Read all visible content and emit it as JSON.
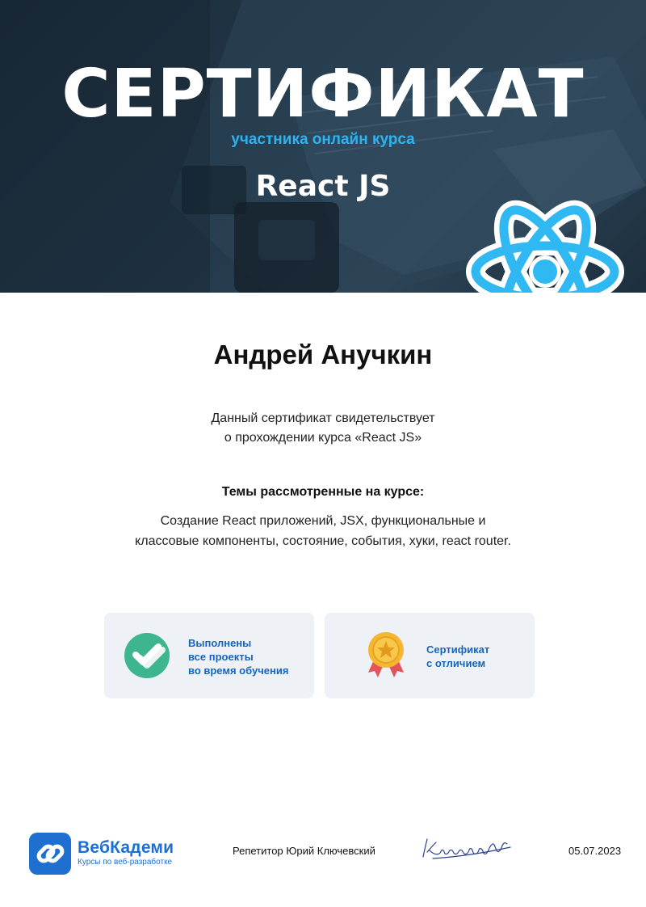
{
  "header": {
    "title": "СЕРТИФИКАТ",
    "subtitle": "участника онлайн курса",
    "course": "React JS"
  },
  "student": {
    "name": "Андрей Анучкин"
  },
  "description": {
    "line1": "Данный сертификат свидетельствует",
    "line2": "о прохождении курса «React JS»"
  },
  "topics": {
    "heading": "Темы рассмотренные на курсе:",
    "line1": "Создание React приложений, JSX, функциональные и",
    "line2": "классовые компоненты, состояние, события, хуки, react router."
  },
  "achievements": [
    {
      "icon": "check-icon",
      "lines": [
        "Выполнены",
        "все проекты",
        "во время обучения"
      ]
    },
    {
      "icon": "medal-icon",
      "lines": [
        "Сертификат",
        "с отличием"
      ]
    }
  ],
  "footer": {
    "brand_name": "ВебКадеми",
    "brand_tagline": "Курсы по веб-разработке",
    "tutor": "Репетитор Юрий Ключевский",
    "date": "05.07.2023"
  },
  "colors": {
    "banner_dark": "#1a2a38",
    "accent_blue": "#2fb3f0",
    "brand_blue": "#1e6fd0",
    "card_bg": "#eef2f7",
    "check_green": "#3db58f",
    "medal_gold": "#f5b731",
    "ribbon_red": "#e2545a"
  }
}
